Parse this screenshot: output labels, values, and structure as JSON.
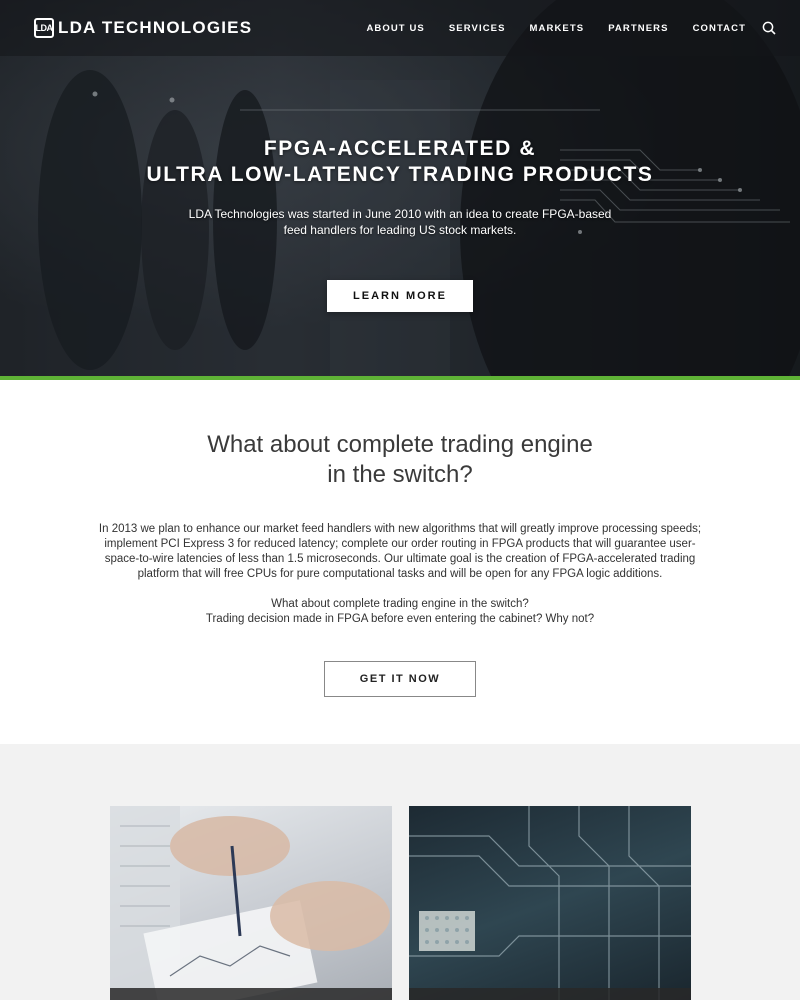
{
  "nav": {
    "logo_mark": "LDA",
    "logo_text": "LDA TECHNOLOGIES",
    "links": [
      "ABOUT US",
      "SERVICES",
      "MARKETS",
      "PARTNERS",
      "CONTACT"
    ],
    "search_icon": "search-icon"
  },
  "hero": {
    "title_line1": "FPGA-ACCELERATED &",
    "title_line2": "ULTRA LOW-LATENCY TRADING PRODUCTS",
    "subtitle": "LDA Technologies was started in June 2010 with an idea to create FPGA-based feed handlers for leading US stock markets.",
    "cta_label": "LEARN MORE"
  },
  "intro": {
    "heading": "What about complete trading engine in the switch?",
    "paragraph": "In 2013 we plan to enhance our market feed handlers with new algorithms that will greatly improve processing speeds; implement PCI Express 3 for reduced latency; complete our order routing in FPGA products that will guarantee user-space-to-wire latencies of less than 1.5 microseconds. Our ultimate goal is the creation of FPGA-accelerated trading platform that will free CPUs for pure computational tasks and will be open for any FPGA logic additions.",
    "question_line1": "What about complete trading engine in the switch?",
    "question_line2": "Trading decision made in FPGA before even entering the cabinet? Why not?",
    "cta_label": "GET IT NOW"
  },
  "colors": {
    "accent_green": "#5fb336",
    "nav_bg": "#141619"
  }
}
